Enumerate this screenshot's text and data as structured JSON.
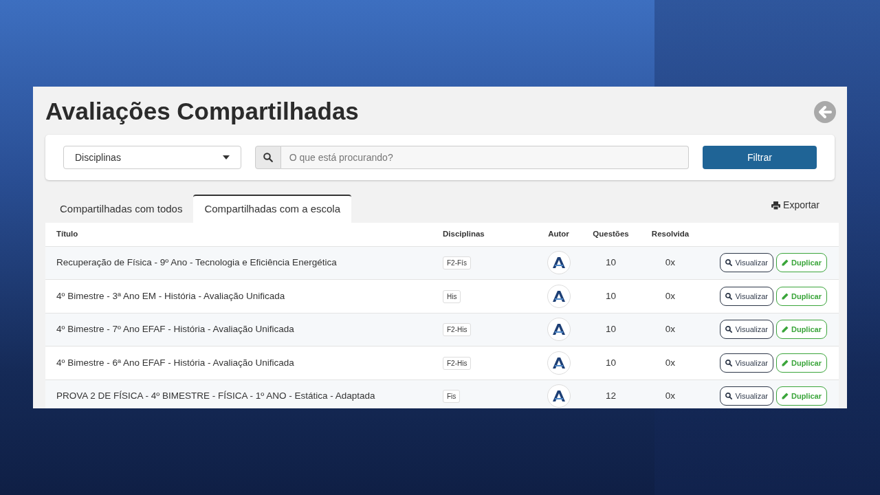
{
  "page": {
    "title": "Avaliações Compartilhadas"
  },
  "filter": {
    "select": "Disciplinas",
    "placeholder": "O que está procurando?",
    "button": "Filtrar"
  },
  "tabs": [
    {
      "label": "Compartilhadas com todos",
      "selected": false
    },
    {
      "label": "Compartilhadas com a escola",
      "selected": true
    }
  ],
  "export": "Exportar",
  "table": {
    "columns": [
      "Título",
      "Disciplinas",
      "Autor",
      "Questões",
      "Resolvida"
    ],
    "rows": [
      {
        "title": "Recuperação de Física - 9º Ano - Tecnologia e Eficiência Energética",
        "discipline": "F2-Fís",
        "questions": "10",
        "solved": "0x",
        "view": "Visualizar",
        "duplicate": "Duplicar"
      },
      {
        "title": "4º Bimestre - 3ª Ano EM - História - Avaliação Unificada",
        "discipline": "His",
        "questions": "10",
        "solved": "0x",
        "view": "Visualizar",
        "duplicate": "Duplicar"
      },
      {
        "title": "4º Bimestre - 7º Ano EFAF - História - Avaliação Unificada",
        "discipline": "F2-His",
        "questions": "10",
        "solved": "0x",
        "view": "Visualizar",
        "duplicate": "Duplicar"
      },
      {
        "title": "4º Bimestre - 6ª Ano EFAF - História - Avaliação Unificada",
        "discipline": "F2-His",
        "questions": "10",
        "solved": "0x",
        "view": "Visualizar",
        "duplicate": "Duplicar"
      },
      {
        "title": "PROVA 2 DE FÍSICA - 4º BIMESTRE - FÍSICA - 1º ANO - Estática - Adaptada",
        "discipline": "Fis",
        "questions": "12",
        "solved": "0x",
        "view": "Visualizar",
        "duplicate": "Duplicar"
      }
    ]
  }
}
